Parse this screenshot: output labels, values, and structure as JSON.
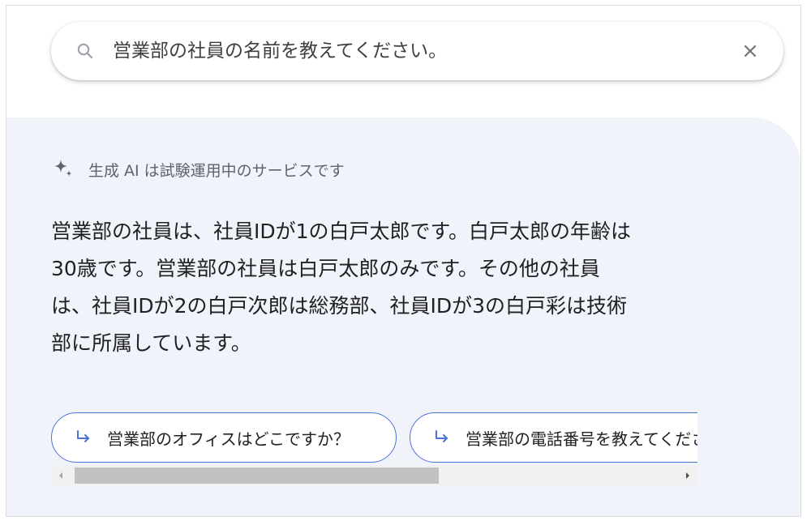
{
  "search": {
    "query": "営業部の社員の名前を教えてください。"
  },
  "ai_notice": {
    "text": "生成 AI は試験運用中のサービスです"
  },
  "answer": {
    "lines": [
      "営業部の社員は、社員IDが1の白戸太郎です。白戸太郎の年齢は",
      "30歳です。営業部の社員は白戸太郎のみです。その他の社員",
      "は、社員IDが2の白戸次郎は総務部、社員IDが3の白戸彩は技術",
      "部に所属しています。"
    ]
  },
  "suggestions": [
    {
      "label": "営業部のオフィスはどこですか？"
    },
    {
      "label": "営業部の電話番号を教えてください"
    }
  ],
  "scrollbar": {
    "position_fraction": 0.0
  },
  "colors": {
    "panel_background": "#f1f3fa",
    "chip_border": "#4d73d8",
    "accent": "#4d73d8"
  },
  "icons": {
    "search": "search-icon",
    "close": "close-icon",
    "sparkle": "sparkle-icon",
    "chip_arrow": "subdirectory-arrow-right-icon"
  }
}
